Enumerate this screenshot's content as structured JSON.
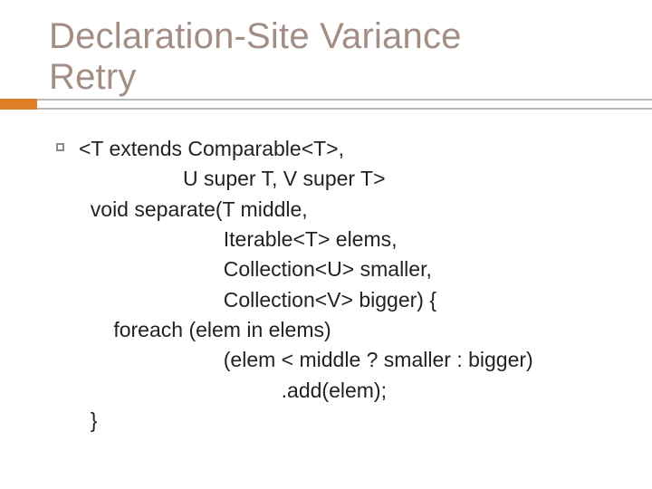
{
  "slide": {
    "title_line1": "Declaration-Site Variance",
    "title_line2": "Retry",
    "code": "<T extends Comparable<T>,\n                  U super T, V super T>\n  void separate(T middle,\n                         Iterable<T> elems,\n                         Collection<U> smaller,\n                         Collection<V> bigger) {\n      foreach (elem in elems)\n                         (elem < middle ? smaller : bigger)\n                                   .add(elem);\n  }"
  }
}
